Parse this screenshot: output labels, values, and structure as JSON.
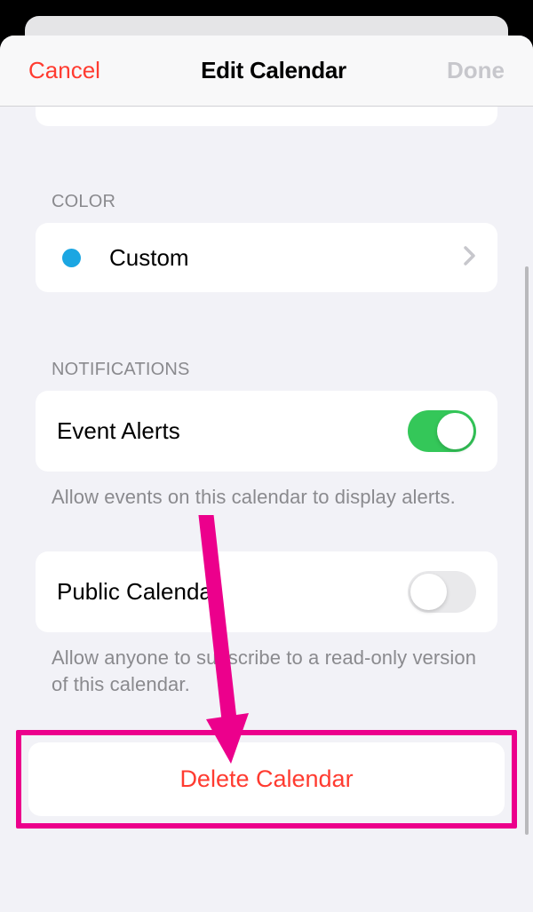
{
  "nav": {
    "cancel_label": "Cancel",
    "title": "Edit Calendar",
    "done_label": "Done"
  },
  "sections": {
    "color": {
      "header": "COLOR",
      "label": "Custom",
      "dot_color": "#1ba6e2"
    },
    "notifications": {
      "header": "NOTIFICATIONS",
      "event_alerts_label": "Event Alerts",
      "event_alerts_on": true,
      "event_alerts_footer": "Allow events on this calendar to display alerts.",
      "public_calendar_label": "Public Calendar",
      "public_calendar_on": false,
      "public_calendar_footer": "Allow anyone to subscribe to a read-only version of this calendar."
    }
  },
  "delete": {
    "label": "Delete Calendar"
  },
  "annotation": {
    "highlight_color": "#ec008c",
    "arrow_color": "#ec008c"
  }
}
